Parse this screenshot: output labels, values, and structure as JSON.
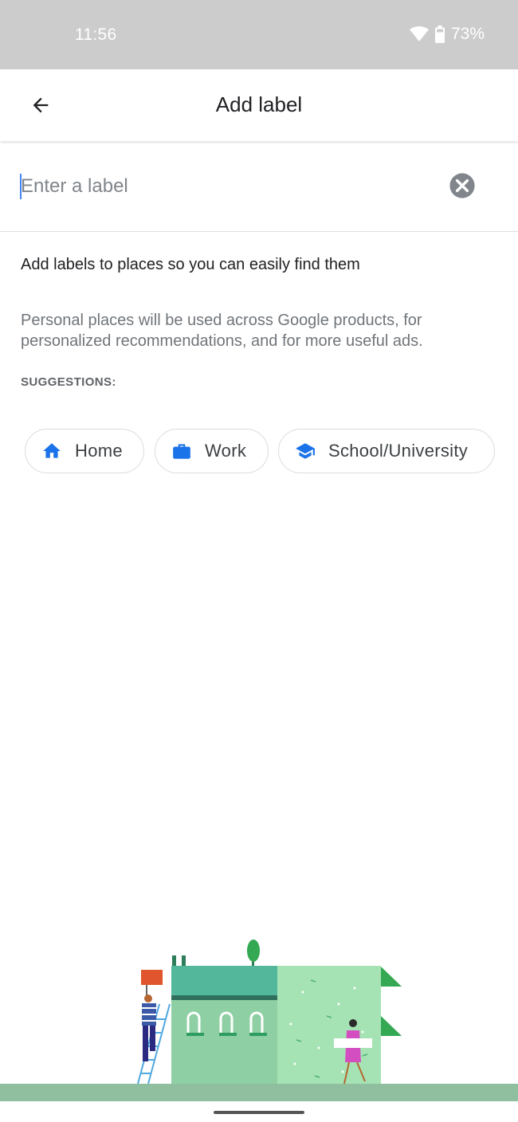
{
  "status": {
    "time": "11:56",
    "battery": "73%"
  },
  "header": {
    "title": "Add label"
  },
  "input": {
    "placeholder": "Enter a label",
    "value": ""
  },
  "texts": {
    "description": "Add labels to places so you can easily find them",
    "note": "Personal places will be used across Google products, for personalized recommendations, and for more useful ads.",
    "suggestions_heading": "SUGGESTIONS:"
  },
  "chips": [
    {
      "label": "Home",
      "icon": "home-icon"
    },
    {
      "label": "Work",
      "icon": "briefcase-icon"
    },
    {
      "label": "School/University",
      "icon": "school-icon"
    }
  ],
  "colors": {
    "accent": "#4285f4",
    "icon_blue": "#1a73e8",
    "status_bar": "#cccccc"
  }
}
